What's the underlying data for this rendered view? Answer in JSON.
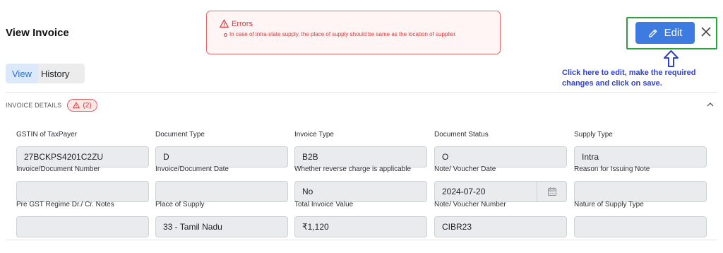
{
  "page": {
    "title": "View Invoice"
  },
  "errors": {
    "heading": "Errors",
    "items": [
      "In case of intra-state supply, the place of supply should be same as the location of supplier."
    ]
  },
  "actions": {
    "edit_label": "Edit"
  },
  "hint": {
    "text": "Click here to edit, make the required changes and click on save."
  },
  "tabs": [
    {
      "label": "View",
      "active": true
    },
    {
      "label": "History",
      "active": false
    }
  ],
  "section": {
    "title": "INVOICE DETAILS",
    "error_count": "(2)"
  },
  "fields": {
    "gstin": {
      "label": "GSTIN of TaxPayer",
      "value": "27BCKPS4201C2ZU"
    },
    "document_type": {
      "label": "Document Type",
      "value": "D"
    },
    "invoice_type": {
      "label": "Invoice Type",
      "value": "B2B"
    },
    "document_status": {
      "label": "Document Status",
      "value": "O"
    },
    "supply_type": {
      "label": "Supply Type",
      "value": "Intra"
    },
    "invoice_number": {
      "label": "Invoice/Document Number",
      "value": ""
    },
    "invoice_date": {
      "label": "Invoice/Document Date",
      "value": ""
    },
    "reverse_charge": {
      "label": "Whether reverse charge is applicable",
      "value": "No"
    },
    "voucher_date": {
      "label": "Note/ Voucher Date",
      "value": "2024-07-20"
    },
    "reason_note": {
      "label": "Reason for Issuing Note",
      "value": ""
    },
    "pre_gst": {
      "label": "Pre GST Regime Dr./ Cr. Notes",
      "value": ""
    },
    "place_of_supply": {
      "label": "Place of Supply",
      "value": "33 - Tamil Nadu"
    },
    "total_value": {
      "label": "Total Invoice Value",
      "value": "₹1,120"
    },
    "voucher_number": {
      "label": "Note/ Voucher Number",
      "value": "CIBR23"
    },
    "nature_supply": {
      "label": "Nature of Supply Type",
      "value": ""
    }
  },
  "colors": {
    "primary": "#3d7be0",
    "error": "#d93636",
    "highlight_frame": "#2aa33a",
    "hint_text": "#2f3fcf"
  },
  "icons": [
    "warning-icon",
    "pencil-icon",
    "close-icon",
    "up-arrow-icon",
    "chevron-up-icon",
    "calendar-icon"
  ]
}
